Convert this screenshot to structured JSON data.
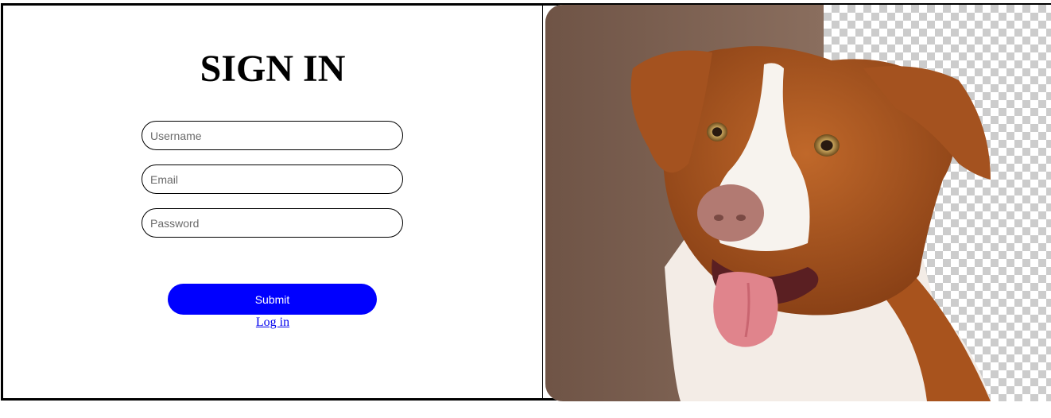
{
  "form": {
    "title": "SIGN IN",
    "username_placeholder": "Username",
    "email_placeholder": "Email",
    "password_placeholder": "Password",
    "submit_label": "Submit",
    "login_link_label": "Log in"
  },
  "hero_image": {
    "subject": "dog-photo",
    "background_note": "transparent-checkerboard"
  },
  "colors": {
    "submit_bg": "#0000ff",
    "submit_text": "#ffffff",
    "link": "#0000ee",
    "border": "#000000"
  }
}
